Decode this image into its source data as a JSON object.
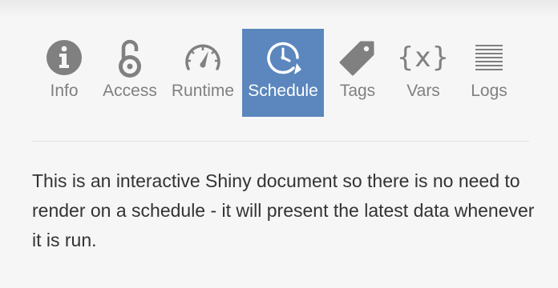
{
  "tabs": [
    {
      "label": "Info",
      "icon": "info-icon"
    },
    {
      "label": "Access",
      "icon": "padlock-icon"
    },
    {
      "label": "Runtime",
      "icon": "speedometer-icon"
    },
    {
      "label": "Schedule",
      "icon": "clock-refresh-icon",
      "active": true
    },
    {
      "label": "Tags",
      "icon": "tag-icon"
    },
    {
      "label": "Vars",
      "icon": "braces-x-icon",
      "glyph": "{x}"
    },
    {
      "label": "Logs",
      "icon": "lines-icon"
    }
  ],
  "schedule": {
    "message": "This is an interactive Shiny document so there is no need to render on a schedule - it will present the latest data whenever it is run."
  },
  "colors": {
    "active_tab": "#5b87be",
    "icon": "#808080",
    "label": "#808080",
    "text": "#333333",
    "background": "#f6f6f6"
  }
}
